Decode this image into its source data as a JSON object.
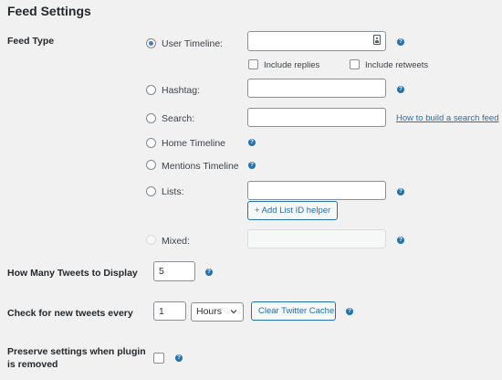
{
  "section_title": "Feed Settings",
  "feed_type": {
    "label": "Feed Type",
    "options": [
      {
        "id": "user-timeline",
        "label": "User Timeline:",
        "checked": true
      },
      {
        "id": "hashtag",
        "label": "Hashtag:",
        "checked": false
      },
      {
        "id": "search",
        "label": "Search:",
        "checked": false
      },
      {
        "id": "home-timeline",
        "label": "Home Timeline",
        "checked": false
      },
      {
        "id": "mentions-timeline",
        "label": "Mentions Timeline",
        "checked": false
      },
      {
        "id": "lists",
        "label": "Lists:",
        "checked": false
      },
      {
        "id": "mixed",
        "label": "Mixed:",
        "checked": false,
        "disabled": true
      }
    ],
    "include_replies_label": "Include replies",
    "include_retweets_label": "Include retweets",
    "search_help_link": "How to build a search feed",
    "add_list_button": "+ Add List ID helper"
  },
  "num_tweets": {
    "label": "How Many Tweets to Display",
    "value": "5"
  },
  "check_new": {
    "label": "Check for new tweets every",
    "value": "1",
    "unit_selected": "Hours",
    "clear_cache_button": "Clear Twitter Cache"
  },
  "preserve": {
    "label_line1": "Preserve settings when plugin",
    "label_line2": "is removed"
  },
  "help_glyph": "?",
  "colors": {
    "accent": "#2271b1",
    "background": "#f1f1f1"
  }
}
